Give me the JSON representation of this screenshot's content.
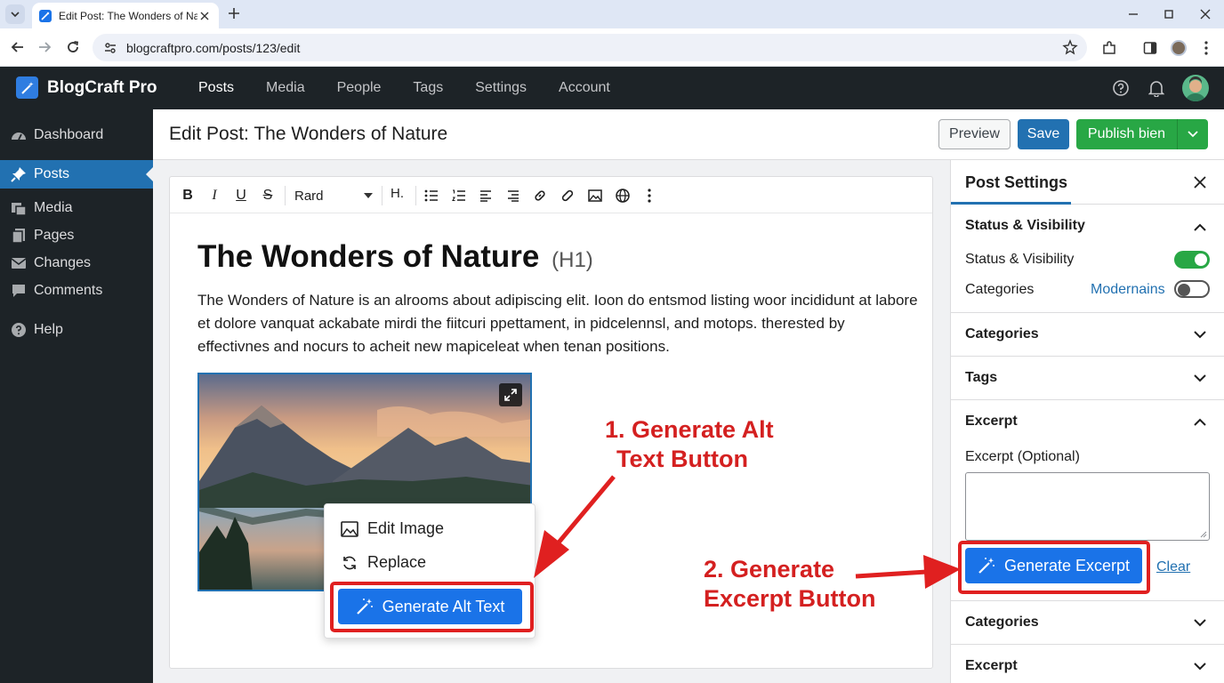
{
  "browser": {
    "tab_title": "Edit Post: The Wonders of Nat",
    "url": "blogcraftpro.com/posts/123/edit"
  },
  "app": {
    "brand": "BlogCraft Pro",
    "nav": [
      "Posts",
      "Media",
      "People",
      "Tags",
      "Settings",
      "Account"
    ],
    "active_nav": "Posts"
  },
  "sidebar": {
    "items": [
      {
        "label": "Dashboard",
        "icon": "dashboard-icon"
      },
      {
        "label": "Posts",
        "icon": "pin-icon",
        "active": true
      },
      {
        "label": "Media",
        "icon": "media-icon"
      },
      {
        "label": "Pages",
        "icon": "pages-icon"
      },
      {
        "label": "Changes",
        "icon": "mail-icon"
      },
      {
        "label": "Comments",
        "icon": "comment-icon"
      },
      {
        "label": "Help",
        "icon": "help-icon"
      }
    ]
  },
  "page": {
    "title": "Edit Post: The Wonders of Nature",
    "preview_label": "Preview",
    "save_label": "Save",
    "publish_label": "Publish bien"
  },
  "editor": {
    "toolbar": {
      "bold": "B",
      "italic": "I",
      "underline": "U",
      "strike": "S",
      "font": "Rard",
      "heading": "H."
    },
    "post_title": "The Wonders of Nature",
    "post_title_tag": "(H1)",
    "body": "The Wonders of Nature is an alrooms about adipiscing elit. Ioon do entsmod listing woor incididunt at labore et dolore vanquat ackabate mirdi the fiitcuri ppettament, in pidcelennsl, and motops. therested by effectivnes and nocurs to acheit new mapiceleat when tenan positions.",
    "context_menu": {
      "edit_image": "Edit Image",
      "replace": "Replace",
      "generate_alt_text": "Generate Alt Text"
    }
  },
  "settings": {
    "tab": "Post Settings",
    "sections": {
      "status_visibility": "Status & Visibility",
      "status_row": "Status & Visibility",
      "categories_row": "Categories",
      "categories_value": "Modernains",
      "categories": "Categories",
      "tags": "Tags",
      "excerpt": "Excerpt",
      "excerpt_label": "Excerpt (Optional)",
      "generate_excerpt": "Generate Excerpt",
      "clear": "Clear",
      "categories_2": "Categories",
      "excerpt_2": "Excerpt"
    },
    "status_toggle_on": true,
    "categories_toggle_on": false
  },
  "annotations": {
    "alt_text_line1": "1. Generate Alt",
    "alt_text_line2": "Text Button",
    "excerpt_line1": "2. Generate",
    "excerpt_line2": "Excerpt Button"
  },
  "colors": {
    "accent": "#2271b1",
    "button_blue": "#1a73e8",
    "publish_green": "#28a745",
    "annotation_red": "#d42020",
    "admin_dark": "#1d2327"
  }
}
